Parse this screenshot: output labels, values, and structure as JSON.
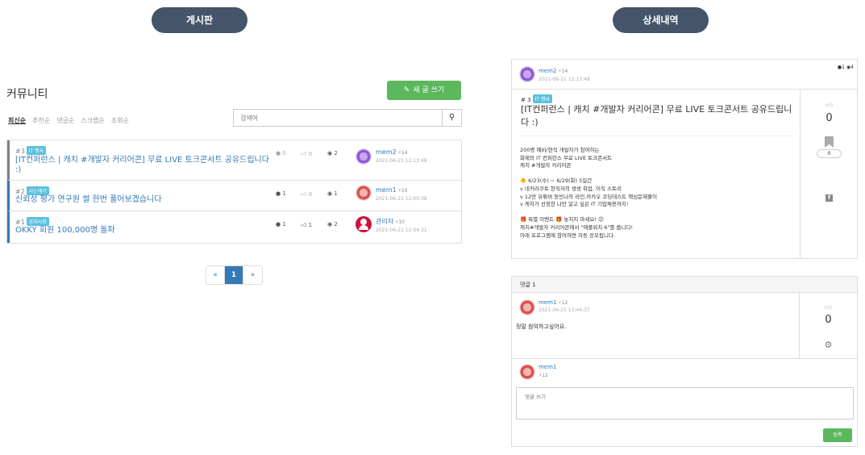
{
  "header": {
    "board_pill": "게시판",
    "detail_pill": "상세내역"
  },
  "board": {
    "title": "커뮤니티",
    "write_button": "새 글 쓰기",
    "sort_tabs": [
      "최신순",
      "추천순",
      "댓글순",
      "스크랩순",
      "조회순"
    ],
    "search_placeholder": "검색어",
    "posts": [
      {
        "num": "#3",
        "badge": "IT 행사",
        "title": "[IT컨퍼런스 | 캐치 #개발자 커리어콘] 무료 LIVE 토크콘서트 공유드립니다 :)",
        "comments": "0",
        "likes": "0",
        "views": "2",
        "user": "mem2",
        "score": "14",
        "date": "2021-06-21 12:13:48"
      },
      {
        "num": "#2",
        "badge": "사는얘기",
        "title": "신뢰성 평가 연구원 썰 한번 풀어보겠습니다",
        "comments": "1",
        "likes": "0",
        "views": "1",
        "user": "mem1",
        "score": "10",
        "date": "2021-06-21 12:09:38"
      },
      {
        "num": "#1",
        "badge": "공지사항",
        "title": "OKKY 회원 100,000명 돌파",
        "comments": "1",
        "likes": "1",
        "views": "2",
        "user": "관리자",
        "score": "10",
        "date": "2021-06-21 12:04:31"
      }
    ],
    "pagination": {
      "prev": "«",
      "current": "1",
      "next": "»"
    }
  },
  "detail": {
    "user": "mem2",
    "score": "14",
    "date": "2021-06-21 12:13:48",
    "comment_count": "1",
    "view_count": "4",
    "num": "# 3",
    "badge": "IT 행사",
    "title": "[IT컨퍼런스 | 캐치 #개발자 커리어콘] 무료 LIVE 토크콘서트 공유드립니다 :)",
    "body": "200명 예비/현직 개발자가 참여하는\n화제의 IT 컨퍼런스 무료 LIVE 토크콘서트\n캐치 #개발자 커리어콘\n\n🐥 6/23(수) ~ 6/29(화) 5일간\nv 네카라쿠토 현직자의 생생 취업, 이직 스토리\nv 12만 유튜버 동빈나의 라인,카카오 코딩테스트 핵심문제풀이\nv 캐치가 선정한 나만 알고 싶은 IT 기업채용까지!\n\n🎁 특별 이벤트 🎁 놓치지 마세요! 😉\n캐치#개발자 커리어콘에서 \"애플워치 6\"를 쏩니다!\n아래 프로그램에 참여하면 자동 응모됩니다.",
    "votes": "0",
    "scrap_count": "0"
  },
  "comments": {
    "header": "댓글 1",
    "items": [
      {
        "user": "mem1",
        "score": "12",
        "date": "2021-06-21 13:44:37",
        "text": "정말 참여하고싶어요.",
        "votes": "0"
      }
    ],
    "writer": {
      "user": "mem1",
      "score": "12"
    },
    "input_placeholder": "댓글 쓰기",
    "submit_label": "등록"
  },
  "colors": {
    "pill": "#44546a",
    "accent_blue": "#337ab7",
    "success_green": "#5cb85c",
    "badge_cyan": "#5bc0de"
  },
  "icons": [
    "pencil-icon",
    "search-icon",
    "comment-icon",
    "thumbs-up-icon",
    "eye-icon",
    "bolt-icon",
    "bookmark-icon",
    "facebook-icon",
    "gear-icon"
  ]
}
